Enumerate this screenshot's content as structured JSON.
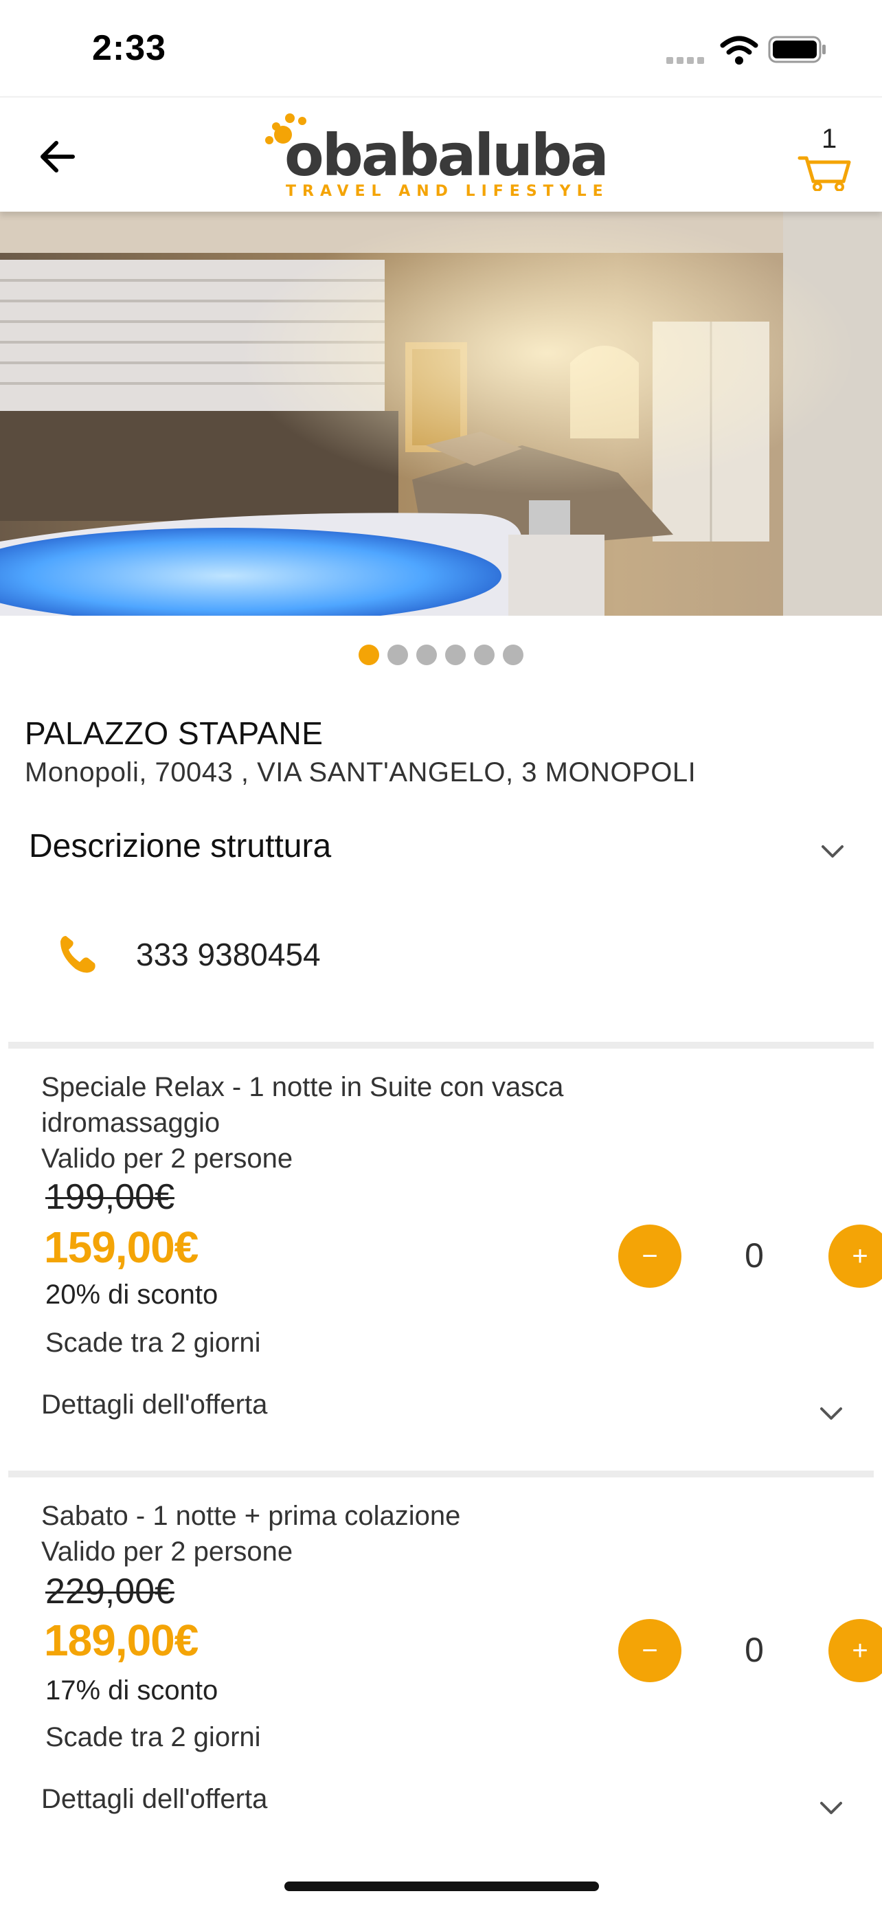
{
  "status_bar": {
    "time": "2:33"
  },
  "header": {
    "logo_text": "obabaluba",
    "logo_tagline": "TRAVEL AND LIFESTYLE",
    "cart_count": "1"
  },
  "carousel": {
    "total": 6,
    "active": 0
  },
  "property": {
    "name": "PALAZZO STAPANE",
    "address": "Monopoli, 70043 , VIA SANT'ANGELO, 3 MONOPOLI",
    "description_label": "Descrizione struttura",
    "phone": "333 9380454"
  },
  "offers": [
    {
      "name": "Speciale Relax - 1 notte in Suite con vasca idromassaggio",
      "validity": "Valido per 2 persone",
      "old_price": "199,00€",
      "new_price": "159,00€",
      "discount": "20% di sconto",
      "expiry": "Scade tra 2 giorni",
      "details_label": "Dettagli dell'offerta",
      "quantity": "0",
      "minus": "−",
      "plus": "+"
    },
    {
      "name": "Sabato - 1 notte + prima colazione",
      "validity": "Valido per 2 persone",
      "old_price": "229,00€",
      "new_price": "189,00€",
      "discount": "17% di sconto",
      "expiry": "Scade tra 2 giorni",
      "details_label": "Dettagli dell'offerta",
      "quantity": "0",
      "minus": "−",
      "plus": "+"
    }
  ],
  "colors": {
    "accent": "#f4a406",
    "dot_inactive": "#b5b5b5"
  }
}
